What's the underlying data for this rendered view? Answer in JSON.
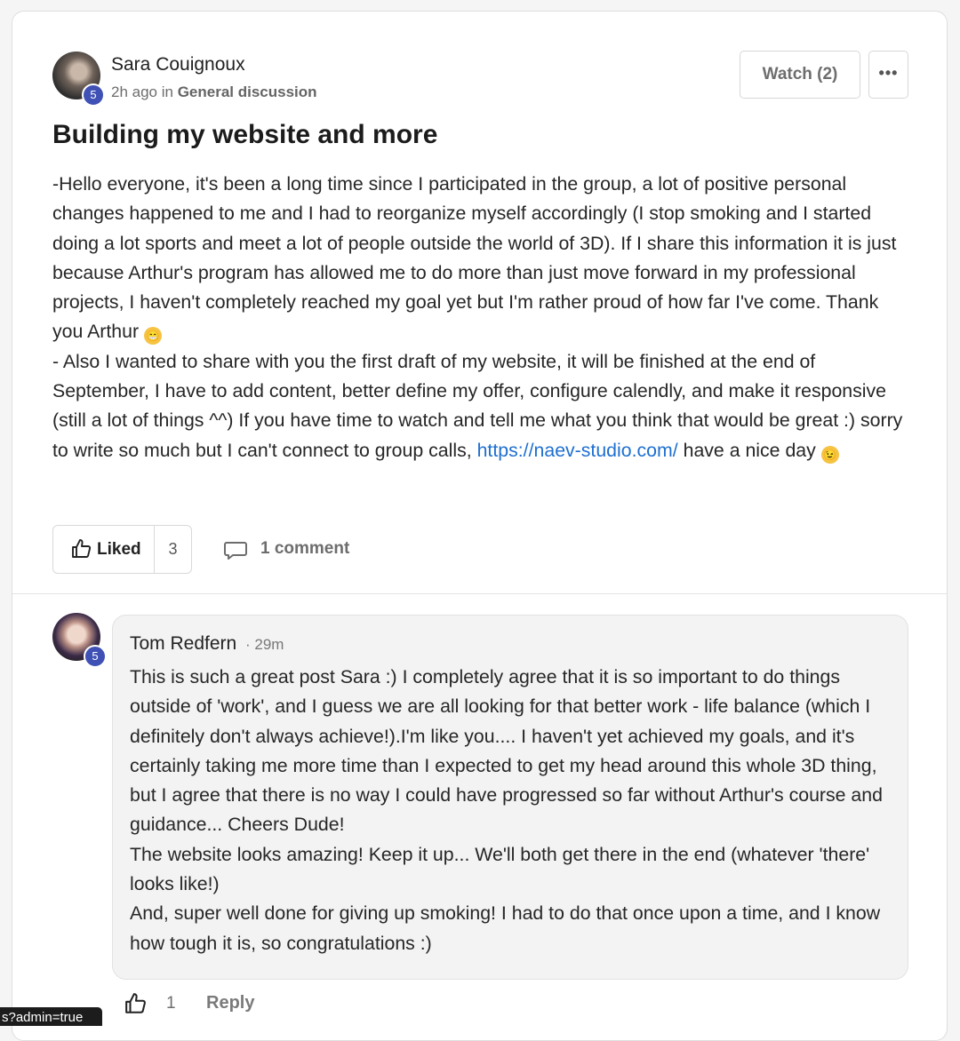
{
  "post": {
    "author": "Sara Couignoux",
    "level": "5",
    "time": "2h ago",
    "in_word": "in",
    "category": "General discussion",
    "watch_label": "Watch (2)",
    "more_label": "•••",
    "title": "Building my website and more",
    "body": {
      "p1": "-Hello everyone, it's been a long time since I participated in the group, a lot of positive personal changes happened to me and I had to reorganize myself accordingly (I stop smoking and I started doing a lot sports and meet a lot of people outside the world of 3D). If I share this information it is just because Arthur's program has allowed me to do more than just move forward in my professional projects, I haven't completely reached my goal yet but I'm rather proud of how far I've come. Thank you Arthur",
      "p2_before_link": "- Also I wanted to share with you the first draft of my website, it will be finished at the end of September, I have to add content, better define my offer, configure calendly, and make it responsive (still a lot of things ^^) If you have time to watch and tell me what you think that would be great :) sorry to write so much but I can't connect to group calls,",
      "link": "https://naev-studio.com/",
      "p2_after_link": "have a nice day"
    },
    "emoji_grin": "😁",
    "emoji_wink": "😉",
    "like_label": "Liked",
    "like_count": "3",
    "comment_count_label": "1 comment"
  },
  "comment": {
    "author": "Tom Redfern",
    "time": "· 29m",
    "level": "5",
    "p1": "This is such a great post Sara :) I completely agree that it is so important to do things outside of 'work', and I guess we are all looking for that better work - life balance (which I definitely don't always achieve!).I'm like you.... I haven't yet achieved my goals, and it's certainly taking me more time than I expected to get my head around this whole 3D thing, but I agree that there is no way I could have progressed so far without Arthur's course and guidance... Cheers Dude!",
    "p2": "The website looks amazing! Keep it up... We'll both get there in the end (whatever 'there' looks like!)",
    "p3": "And, super well done for giving up smoking! I had to do that once upon a time, and I know how tough it is, so congratulations :)",
    "like_count": "1",
    "reply_label": "Reply"
  },
  "status_url": "s?admin=true",
  "colors": {
    "link": "#1e6fd0",
    "level_badge": "#3f51b5",
    "bubble_bg": "#f3f3f3"
  },
  "icons": [
    "thumbs-up-icon",
    "comment-icon",
    "more-dots-icon"
  ]
}
